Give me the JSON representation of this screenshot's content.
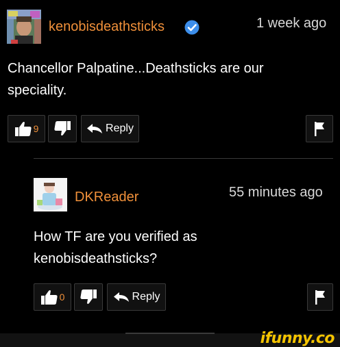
{
  "comment": {
    "username": "kenobisdeathsticks",
    "verified": true,
    "timestamp": "1 week ago",
    "text": "Chancellor Palpatine...Deathsticks are our speciality.",
    "likes": "9",
    "reply_label": "Reply"
  },
  "reply": {
    "username": "DKReader",
    "timestamp": "55 minutes ago",
    "text": "How TF are you verified as kenobisdeathsticks?",
    "likes": "0",
    "reply_label": "Reply"
  },
  "icons": {
    "like": "thumbs-up-icon",
    "dislike": "thumbs-down-icon",
    "reply": "reply-arrow-icon",
    "flag": "flag-icon",
    "verified": "verified-check-icon"
  },
  "colors": {
    "username": "#f0903a",
    "verified": "#3d8eea",
    "watermark": "#f5c400",
    "background": "#000000"
  },
  "watermark": "ifunny.co"
}
